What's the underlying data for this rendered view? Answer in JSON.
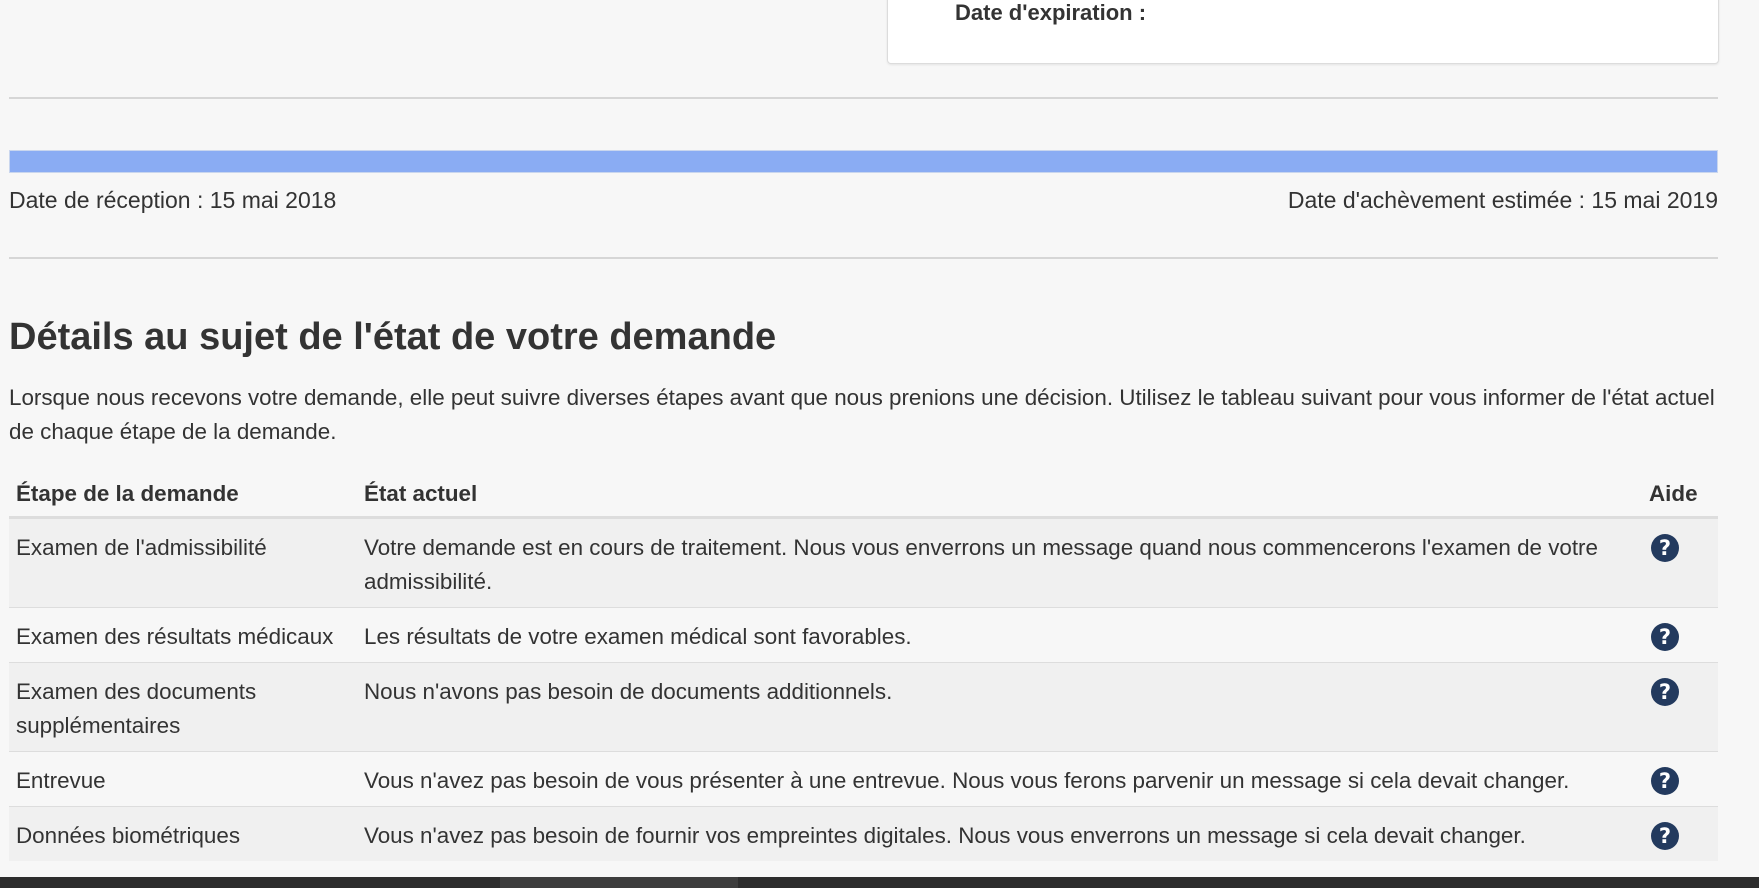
{
  "expiry_card": {
    "label": "Date d'expiration :"
  },
  "progress": {
    "fraction": 1.0,
    "color": "#8aacf3"
  },
  "dates": {
    "received": "Date de réception : 15 mai 2018",
    "estimated_completion": "Date d'achèvement estimée : 15 mai 2019"
  },
  "details": {
    "title": "Détails au sujet de l'état de votre demande",
    "intro": "Lorsque nous recevons votre demande, elle peut suivre diverses étapes avant que nous prenions une décision. Utilisez le tableau suivant pour vous informer de l'état actuel de chaque étape de la demande."
  },
  "table": {
    "headers": {
      "stage": "Étape de la demande",
      "status": "État actuel",
      "help": "Aide"
    },
    "rows": [
      {
        "stage": "Examen de l'admissibilité",
        "status": "Votre demande est en cours de traitement. Nous vous enverrons un message quand nous commencerons l'examen de votre admissibilité.",
        "help_icon": "question-circle-icon"
      },
      {
        "stage": "Examen des résultats médicaux",
        "status": "Les résultats de votre examen médical sont favorables.",
        "help_icon": "question-circle-icon"
      },
      {
        "stage": "Examen des documents supplémentaires",
        "status": "Nous n'avons pas besoin de documents additionnels.",
        "help_icon": "question-circle-icon"
      },
      {
        "stage": "Entrevue",
        "status": "Vous n'avez pas besoin de vous présenter à une entrevue. Nous vous ferons parvenir un message si cela devait changer.",
        "help_icon": "question-circle-icon"
      },
      {
        "stage": "Données biométriques",
        "status": "Vous n'avez pas besoin de fournir vos empreintes digitales. Nous vous enverrons un message si cela devait changer.",
        "help_icon": "question-circle-icon"
      }
    ]
  },
  "colors": {
    "help_icon_bg": "#233a5e",
    "text": "#333333",
    "page_bg": "#f7f7f7"
  }
}
